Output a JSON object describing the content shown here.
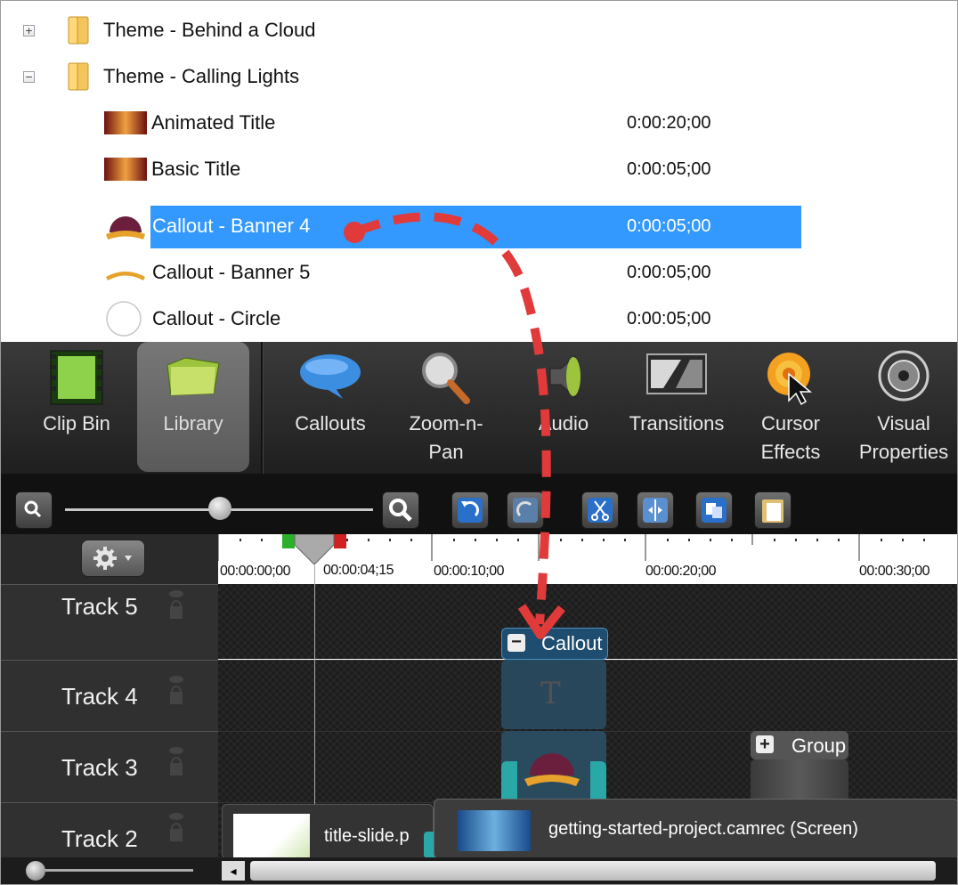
{
  "library": {
    "folders": [
      {
        "expander": "+",
        "name": "Theme - Behind a Cloud"
      },
      {
        "expander": "−",
        "name": "Theme - Calling Lights"
      }
    ],
    "items": [
      {
        "name": "Animated Title",
        "duration": "0:00:20;00"
      },
      {
        "name": "Basic Title",
        "duration": "0:00:05;00"
      },
      {
        "name": "Callout - Banner 4",
        "duration": "0:00:05;00",
        "selected": true
      },
      {
        "name": "Callout - Banner 5",
        "duration": "0:00:05;00"
      },
      {
        "name": "Callout - Circle",
        "duration": "0:00:05;00"
      }
    ]
  },
  "tabs": [
    {
      "id": "clip-bin",
      "label1": "Clip Bin",
      "label2": "",
      "icon": "film-strip-icon"
    },
    {
      "id": "library",
      "label1": "Library",
      "label2": "",
      "icon": "open-folder-icon",
      "active": true
    },
    {
      "id": "callouts",
      "label1": "Callouts",
      "label2": "",
      "icon": "speech-bubble-icon"
    },
    {
      "id": "zoom-n-pan",
      "label1": "Zoom-n-",
      "label2": "Pan",
      "icon": "magnifier-icon"
    },
    {
      "id": "audio",
      "label1": "Audio",
      "label2": "",
      "icon": "speaker-icon"
    },
    {
      "id": "transitions",
      "label1": "Transitions",
      "label2": "",
      "icon": "transition-icon"
    },
    {
      "id": "cursor-effects",
      "label1": "Cursor",
      "label2": "Effects",
      "icon": "cursor-highlight-icon"
    },
    {
      "id": "visual-properties",
      "label1": "Visual",
      "label2": "Properties",
      "icon": "film-reel-icon"
    }
  ],
  "ruler": {
    "playhead_time": "0:00:04;15",
    "labels": [
      "00:00:00;00",
      "00:00:04;15",
      "00:00:10;00",
      "00:00:20;00",
      "00:00:30;00"
    ]
  },
  "tracks": [
    "Track 5",
    "Track 4",
    "Track 3",
    "Track 2"
  ],
  "clips": {
    "callout_group": "Callout",
    "group": "Group",
    "title_clip": "title-slide.p",
    "screen_clip": "getting-started-project.camrec (Screen)"
  },
  "colors": {
    "selection": "#3399ff",
    "drag_arrow": "#e03a3a",
    "clip_teal": "#2aa7a7"
  }
}
